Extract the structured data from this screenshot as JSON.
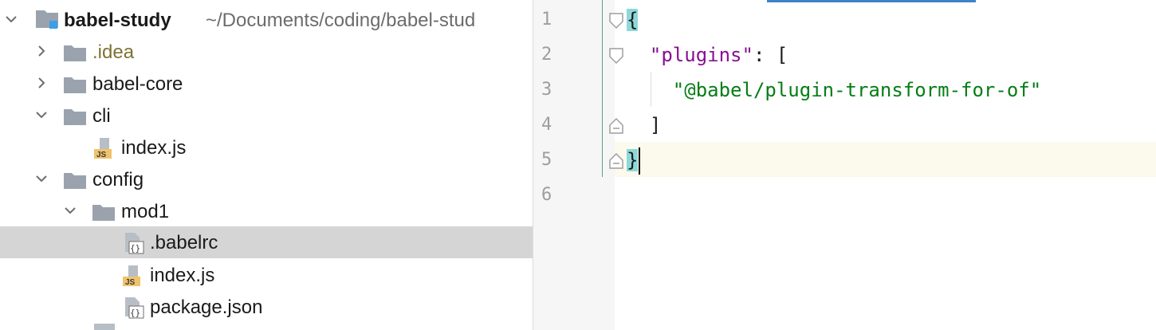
{
  "project_tree": {
    "root": {
      "name": "babel-study",
      "path": "~/Documents/coding/babel-stud"
    },
    "items": [
      {
        "label": ".idea",
        "kind": "folder",
        "expanded": false,
        "depth": 1
      },
      {
        "label": "babel-core",
        "kind": "folder",
        "expanded": false,
        "depth": 1
      },
      {
        "label": "cli",
        "kind": "folder",
        "expanded": true,
        "depth": 1
      },
      {
        "label": "index.js",
        "kind": "js-file",
        "depth": 2
      },
      {
        "label": "config",
        "kind": "folder",
        "expanded": true,
        "depth": 1
      },
      {
        "label": "mod1",
        "kind": "folder",
        "expanded": true,
        "depth": 2
      },
      {
        "label": ".babelrc",
        "kind": "json-file",
        "depth": 3,
        "selected": true
      },
      {
        "label": "index.js",
        "kind": "js-file",
        "depth": 3
      },
      {
        "label": "package.json",
        "kind": "json-file",
        "depth": 3
      }
    ],
    "js_badge": "JS",
    "json_badge": "{}"
  },
  "editor": {
    "line_numbers": [
      "1",
      "2",
      "3",
      "4",
      "5",
      "6"
    ],
    "code": {
      "line1_brace": "{",
      "line2_key": "\"plugins\"",
      "line2_rest": ": [",
      "line3_string": "\"@babel/plugin-transform-for-of\"",
      "line4": "]",
      "line5_brace": "}"
    },
    "current_line": 5
  },
  "colors": {
    "selection_bg": "#d5d5d5",
    "brace_match": "#8ed8d9",
    "json_key": "#871094",
    "json_string": "#067d17",
    "current_line_bg": "#fcfaed",
    "tab_accent": "#4083c9"
  }
}
